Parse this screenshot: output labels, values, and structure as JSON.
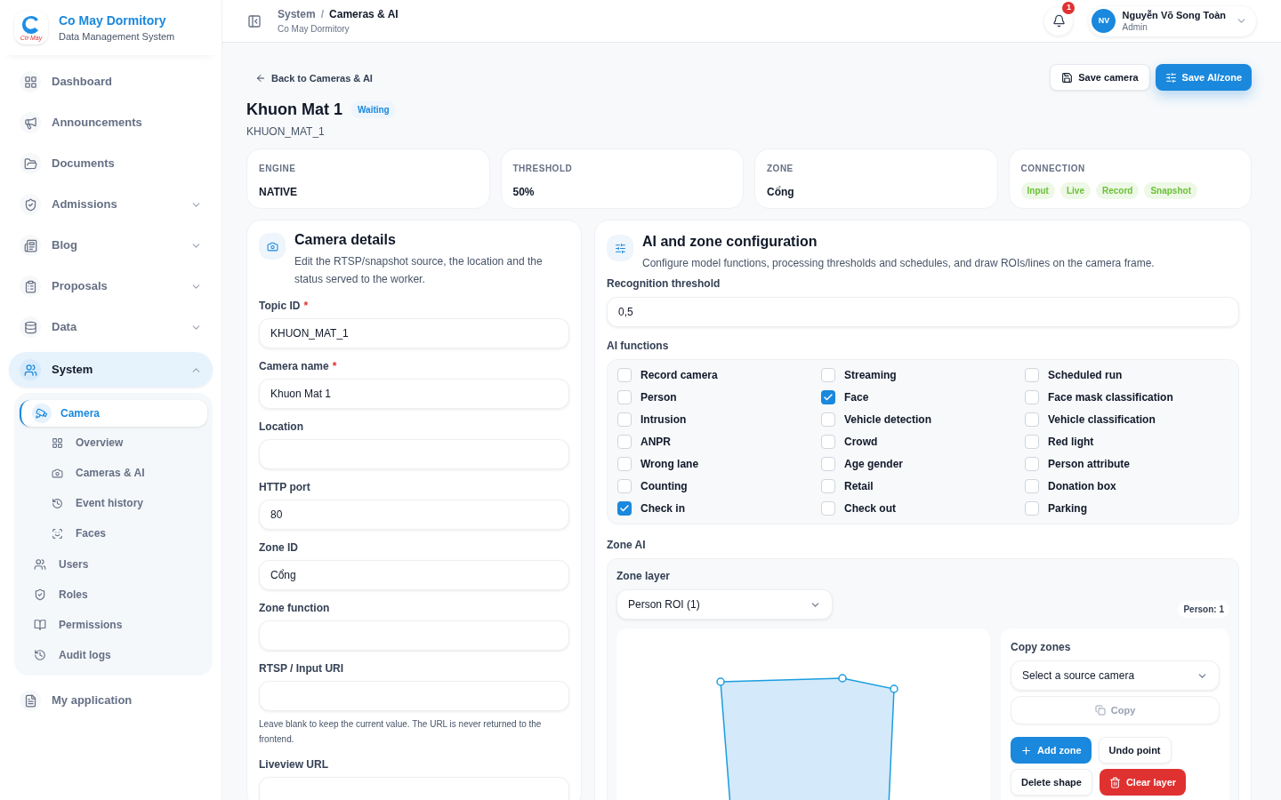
{
  "sidebar": {
    "brand": {
      "logo_text": "Cơ May",
      "name": "Co May Dormitory",
      "subtitle": "Data Management System"
    },
    "items": [
      {
        "label": "Dashboard",
        "expandable": false,
        "selected": false
      },
      {
        "label": "Announcements",
        "expandable": false,
        "selected": false
      },
      {
        "label": "Documents",
        "expandable": false,
        "selected": false
      },
      {
        "label": "Admissions",
        "expandable": true,
        "expanded": false,
        "selected": false
      },
      {
        "label": "Blog",
        "expandable": true,
        "expanded": false,
        "selected": false
      },
      {
        "label": "Proposals",
        "expandable": true,
        "expanded": false,
        "selected": false
      },
      {
        "label": "Data",
        "expandable": true,
        "expanded": false,
        "selected": false
      },
      {
        "label": "System",
        "expandable": true,
        "expanded": true,
        "selected": true,
        "children": [
          {
            "label": "Camera",
            "selected": true,
            "children": [
              {
                "label": "Overview",
                "selected": false
              },
              {
                "label": "Cameras & AI",
                "selected": false
              },
              {
                "label": "Event history",
                "selected": false
              },
              {
                "label": "Faces",
                "selected": false
              }
            ]
          },
          {
            "label": "Users",
            "selected": false
          },
          {
            "label": "Roles",
            "selected": false
          },
          {
            "label": "Permissions",
            "selected": false
          },
          {
            "label": "Audit logs",
            "selected": false
          }
        ]
      },
      {
        "label": "My application",
        "expandable": false,
        "selected": false
      }
    ]
  },
  "header": {
    "breadcrumb": [
      "System",
      "Cameras & AI"
    ],
    "breadcrumb_separator": "/",
    "subtitle": "Co May Dormitory",
    "notifications": "1",
    "user": {
      "initials": "NV",
      "name": "Nguyễn Võ Song Toàn",
      "role": "Admin"
    }
  },
  "page": {
    "back": "Back to Cameras & AI",
    "actions": [
      "Save camera",
      "Save AI/zone"
    ],
    "title": "Khuon Mat 1",
    "status": "Waiting",
    "code": "KHUON_MAT_1",
    "stats": [
      {
        "label": "ENGINE",
        "value": "NATIVE"
      },
      {
        "label": "THRESHOLD",
        "value": "50%"
      },
      {
        "label": "ZONE",
        "value": "Cổng"
      }
    ],
    "connection": {
      "label": "CONNECTION",
      "tags": [
        "Input",
        "Live",
        "Record",
        "Snapshot"
      ]
    }
  },
  "camera_details": {
    "required_mark": "*",
    "title": "Camera details",
    "description": "Edit the RTSP/snapshot source, the location and the status served to the worker.",
    "fields": [
      {
        "label": "Topic ID",
        "required": true,
        "value": "KHUON_MAT_1"
      },
      {
        "label": "Camera name",
        "required": true,
        "value": "Khuon Mat 1"
      },
      {
        "label": "Location",
        "required": false
      },
      {
        "label": "HTTP port",
        "required": false,
        "value": "80"
      },
      {
        "label": "Zone ID",
        "required": false,
        "value": "Cổng"
      },
      {
        "label": "Zone function",
        "required": false
      },
      {
        "label": "RTSP / Input URI",
        "required": false,
        "hint": "Leave blank to keep the current value. The URL is never returned to the frontend."
      },
      {
        "label": "Liveview URL",
        "required": false
      }
    ]
  },
  "ai": {
    "title": "AI and zone configuration",
    "description": "Configure model functions, processing thresholds and schedules, and draw ROIs/lines on the camera frame.",
    "threshold_label": "Recognition threshold",
    "threshold": "0,5",
    "functions_label": "AI functions",
    "functions": [
      {
        "label": "Record camera",
        "checked": false
      },
      {
        "label": "Streaming",
        "checked": false
      },
      {
        "label": "Scheduled run",
        "checked": false
      },
      {
        "label": "Person",
        "checked": false
      },
      {
        "label": "Face",
        "checked": true
      },
      {
        "label": "Face mask classification",
        "checked": false
      },
      {
        "label": "Intrusion",
        "checked": false
      },
      {
        "label": "Vehicle detection",
        "checked": false
      },
      {
        "label": "Vehicle classification",
        "checked": false
      },
      {
        "label": "ANPR",
        "checked": false
      },
      {
        "label": "Crowd",
        "checked": false
      },
      {
        "label": "Red light",
        "checked": false
      },
      {
        "label": "Wrong lane",
        "checked": false
      },
      {
        "label": "Age gender",
        "checked": false
      },
      {
        "label": "Person attribute",
        "checked": false
      },
      {
        "label": "Counting",
        "checked": false
      },
      {
        "label": "Retail",
        "checked": false
      },
      {
        "label": "Donation box",
        "checked": false
      },
      {
        "label": "Check in",
        "checked": true
      },
      {
        "label": "Check out",
        "checked": false
      },
      {
        "label": "Parking",
        "checked": false
      }
    ],
    "zone": {
      "label": "Zone AI",
      "layer_label": "Zone layer",
      "layer": "Person ROI (1)",
      "count": "Person: 1",
      "copy": {
        "label": "Copy zones",
        "placeholder": "Select a source camera",
        "button": "Copy"
      },
      "tools": [
        {
          "label": "Add zone",
          "kind": "primary"
        },
        {
          "label": "Undo point",
          "kind": "plain"
        },
        {
          "label": "Delete shape",
          "kind": "plain"
        },
        {
          "label": "Clear layer",
          "kind": "danger"
        }
      ]
    }
  }
}
